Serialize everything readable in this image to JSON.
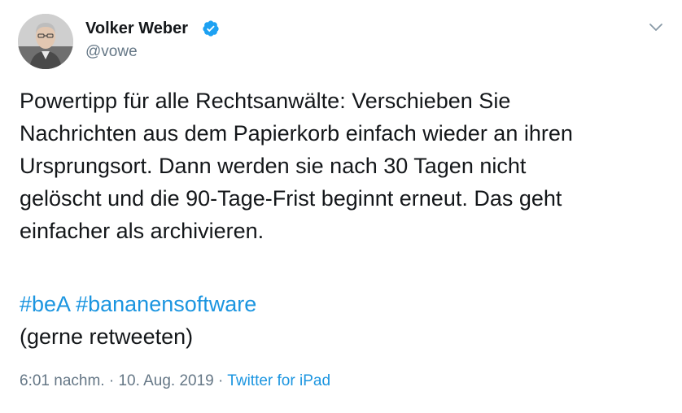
{
  "author": {
    "display_name": "Volker Weber",
    "handle": "@vowe",
    "verified": true
  },
  "tweet": {
    "lines": [
      "Powertipp für alle Rechtsanwälte: Verschieben Sie",
      "Nachrichten aus dem Papierkorb einfach wieder an ihren",
      "Ursprungsort. Dann werden sie nach 30 Tagen nicht",
      "gelöscht und die 90-Tage-Frist beginnt erneut. Das geht",
      "einfacher als archivieren."
    ],
    "hashtags": [
      "#beA",
      "#bananensoftware"
    ],
    "tail": "(gerne retweeten)"
  },
  "meta": {
    "time": "6:01 nachm.",
    "separator": "·",
    "date": "10. Aug. 2019",
    "source": "Twitter for iPad"
  },
  "colors": {
    "accent": "#1b95e0",
    "muted": "#657786",
    "text": "#14171a"
  },
  "icons": {
    "verified": "verified-badge-icon",
    "menu": "chevron-down-icon"
  }
}
